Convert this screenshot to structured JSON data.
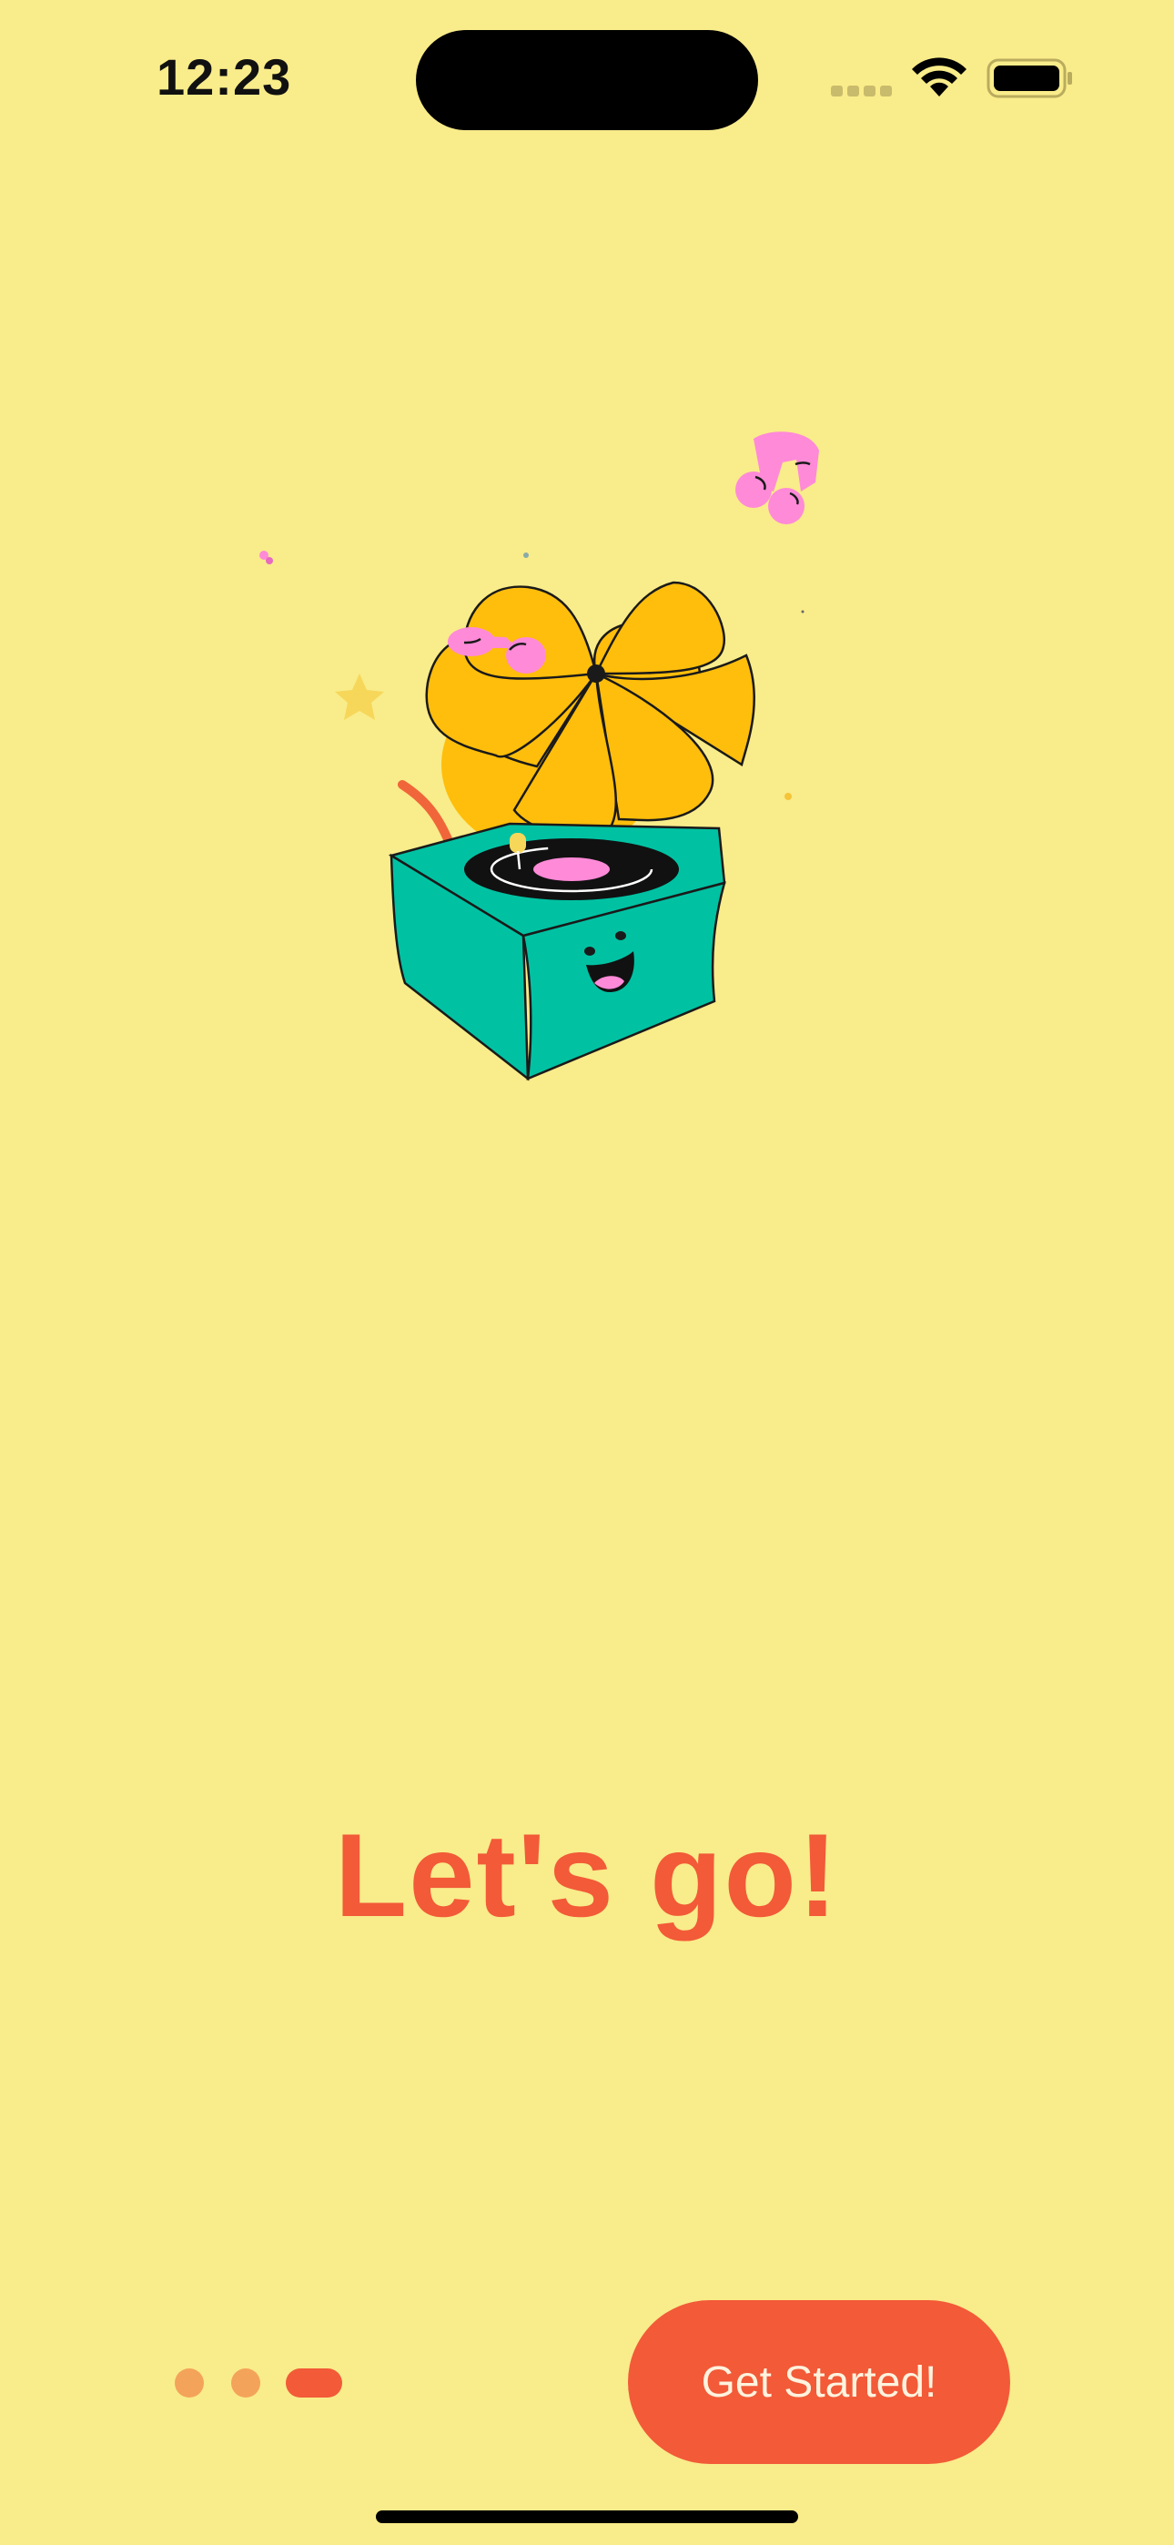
{
  "status_bar": {
    "time": "12:23",
    "icons": [
      "cellular-signal-icon",
      "wifi-icon",
      "battery-icon"
    ]
  },
  "illustration": {
    "icon": "gramophone-illustration",
    "accents": [
      "music-note-icon",
      "star-icon"
    ]
  },
  "onboarding": {
    "headline": "Let's go!",
    "page_indicator": {
      "total": 3,
      "current": 3
    },
    "cta_label": "Get Started!"
  },
  "colors": {
    "background": "#F9EC8A",
    "accent": "#F25A38",
    "dot_inactive": "#F4A35A",
    "horn": "#FFBE0B",
    "box": "#00C2A3",
    "pink": "#FF8AD8"
  }
}
